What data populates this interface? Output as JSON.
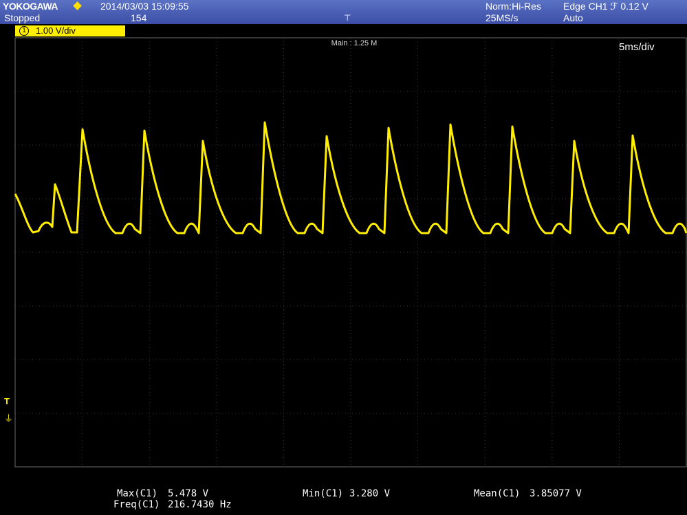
{
  "header": {
    "brand": "YOKOGAWA",
    "status": "Stopped",
    "datetime": "2014/03/03  15:09:55",
    "acquisition_count": "154",
    "mode": "Norm:Hi-Res",
    "sample_rate": "25MS/s",
    "trigger": "Edge CH1 ℱ 0.12 V",
    "trigger_mode": "Auto",
    "trigger_position_icon": "trigger-position-icon"
  },
  "channel": {
    "number": "1",
    "scale": "1.00 V/div",
    "color": "#ffee00"
  },
  "display": {
    "main_label": "Main : 1.25 M",
    "timebase": "5ms/div",
    "trigger_level_marker": "T",
    "ground_marker": "⏚"
  },
  "measurements": {
    "max_label": "Max(C1)",
    "max_value": "5.478 V",
    "freq_label": "Freq(C1)",
    "freq_value": "216.7430 Hz",
    "min_label": "Min(C1)",
    "min_value": "3.280 V",
    "mean_label": "Mean(C1)",
    "mean_value": "3.85077 V"
  }
}
